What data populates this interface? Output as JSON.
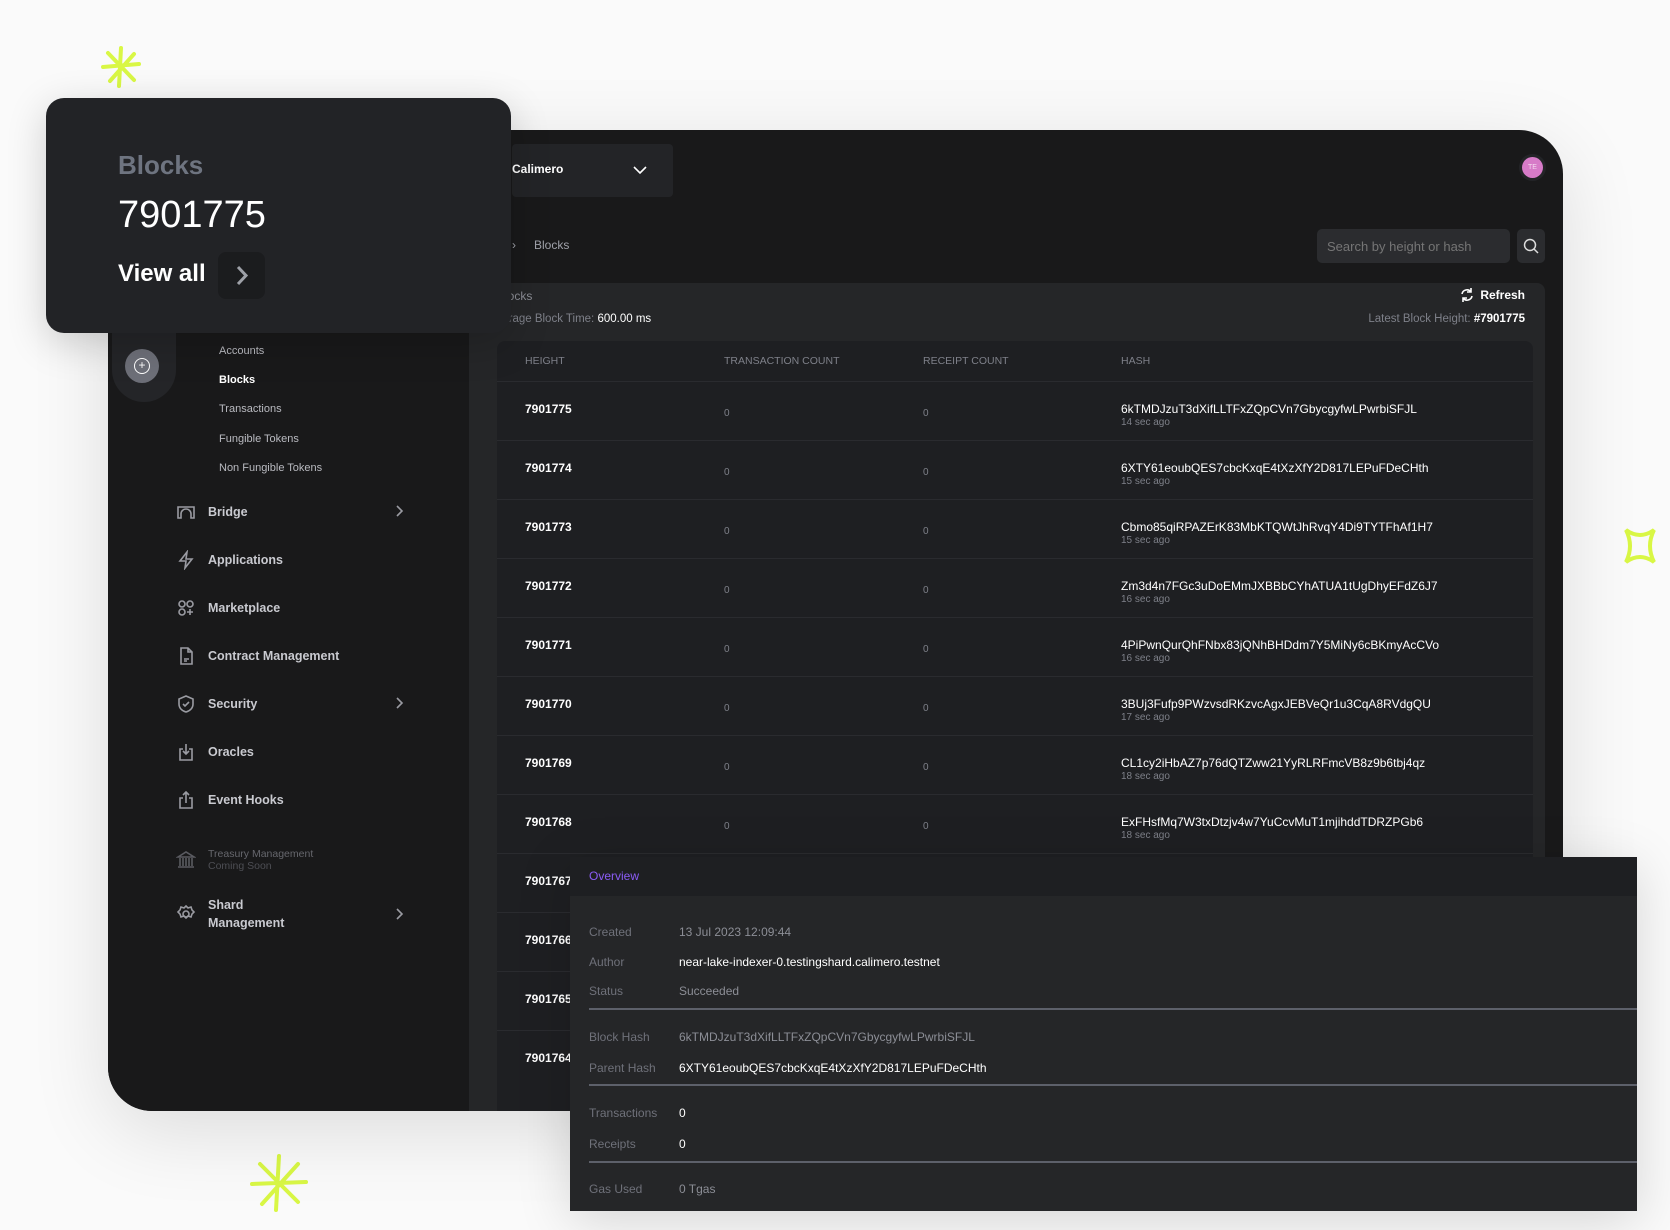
{
  "card": {
    "title": "Blocks",
    "count": "7901775",
    "view_all": "View all"
  },
  "header": {
    "network": "Calimero",
    "breadcrumb": "Blocks",
    "avatar": "TE",
    "search_placeholder": "Search by height or hash"
  },
  "sidebar": {
    "sub_items": [
      "Accounts",
      "Blocks",
      "Transactions",
      "Fungible Tokens",
      "Non Fungible Tokens"
    ],
    "items": [
      {
        "label": "Bridge",
        "icon": "bridge-icon",
        "chevron": true
      },
      {
        "label": "Applications",
        "icon": "lightning-icon",
        "chevron": false
      },
      {
        "label": "Marketplace",
        "icon": "grid-plus-icon",
        "chevron": false
      },
      {
        "label": "Contract Management",
        "icon": "document-icon",
        "chevron": false
      },
      {
        "label": "Security",
        "icon": "shield-check-icon",
        "chevron": true
      },
      {
        "label": "Oracles",
        "icon": "download-box-icon",
        "chevron": false
      },
      {
        "label": "Event Hooks",
        "icon": "share-icon",
        "chevron": false
      }
    ],
    "treasury": {
      "label": "Treasury Management",
      "note": "Coming Soon"
    },
    "shard": {
      "line1": "Shard",
      "line2": "Management"
    }
  },
  "panel": {
    "title": "Blocks",
    "refresh": "Refresh",
    "avg_label": "Average Block Time:",
    "avg_value": "600.00 ms",
    "latest_label": "Latest Block Height:",
    "latest_value": "#7901775",
    "columns": [
      "HEIGHT",
      "TRANSACTION COUNT",
      "RECEIPT COUNT",
      "HASH"
    ],
    "rows": [
      {
        "height": "7901775",
        "tx": "0",
        "rc": "0",
        "hash": "6kTMDJzuT3dXifLLTFxZQpCVn7GbycgyfwLPwrbiSFJL",
        "ago": "14 sec ago"
      },
      {
        "height": "7901774",
        "tx": "0",
        "rc": "0",
        "hash": "6XTY61eoubQES7cbcKxqE4tXzXfY2D817LEPuFDeCHth",
        "ago": "15 sec ago"
      },
      {
        "height": "7901773",
        "tx": "0",
        "rc": "0",
        "hash": "Cbmo85qiRPAZErK83MbKTQWtJhRvqY4Di9TYTFhAf1H7",
        "ago": "15 sec ago"
      },
      {
        "height": "7901772",
        "tx": "0",
        "rc": "0",
        "hash": "Zm3d4n7FGc3uDoEMmJXBBbCYhATUA1tUgDhyEFdZ6J7",
        "ago": "16 sec ago"
      },
      {
        "height": "7901771",
        "tx": "0",
        "rc": "0",
        "hash": "4PiPwnQurQhFNbx83jQNhBHDdm7Y5MiNy6cBKmyAcCVo",
        "ago": "16 sec ago"
      },
      {
        "height": "7901770",
        "tx": "0",
        "rc": "0",
        "hash": "3BUj3Fufp9PWzvsdRKzvcAgxJEBVeQr1u3CqA8RVdgQU",
        "ago": "17 sec ago"
      },
      {
        "height": "7901769",
        "tx": "0",
        "rc": "0",
        "hash": "CL1cy2iHbAZ7p76dQTZww21YyRLRFmcVB8z9b6tbj4qz",
        "ago": "18 sec ago"
      },
      {
        "height": "7901768",
        "tx": "0",
        "rc": "0",
        "hash": "ExFHsfMq7W3txDtzjv4w7YuCcvMuT1mjihddTDRZPGb6",
        "ago": "18 sec ago"
      },
      {
        "height": "7901767"
      },
      {
        "height": "7901766"
      },
      {
        "height": "7901765"
      },
      {
        "height": "7901764"
      }
    ]
  },
  "overview": {
    "tab": "Overview",
    "fields": [
      {
        "label": "Created",
        "value": "13 Jul 2023 12:09:44",
        "dim": true
      },
      {
        "label": "Author",
        "value": "near-lake-indexer-0.testingshard.calimero.testnet"
      },
      {
        "label": "Status",
        "value": "Succeeded",
        "dim": true
      },
      {
        "label": "Block Hash",
        "value": "6kTMDJzuT3dXifLLTFxZQpCVn7GbycgyfwLPwrbiSFJL",
        "dim": true
      },
      {
        "label": "Parent Hash",
        "value": "6XTY61eoubQES7cbcKxqE4tXzXfY2D817LEPuFDeCHth"
      },
      {
        "label": "Transactions",
        "value": "0"
      },
      {
        "label": "Receipts",
        "value": "0"
      },
      {
        "label": "Gas Used",
        "value": "0 Tgas",
        "dim": true
      }
    ]
  },
  "colors": {
    "accent": "#8b5cf6",
    "sparkle": "#d9f745",
    "avatar": "#d77bc8"
  }
}
